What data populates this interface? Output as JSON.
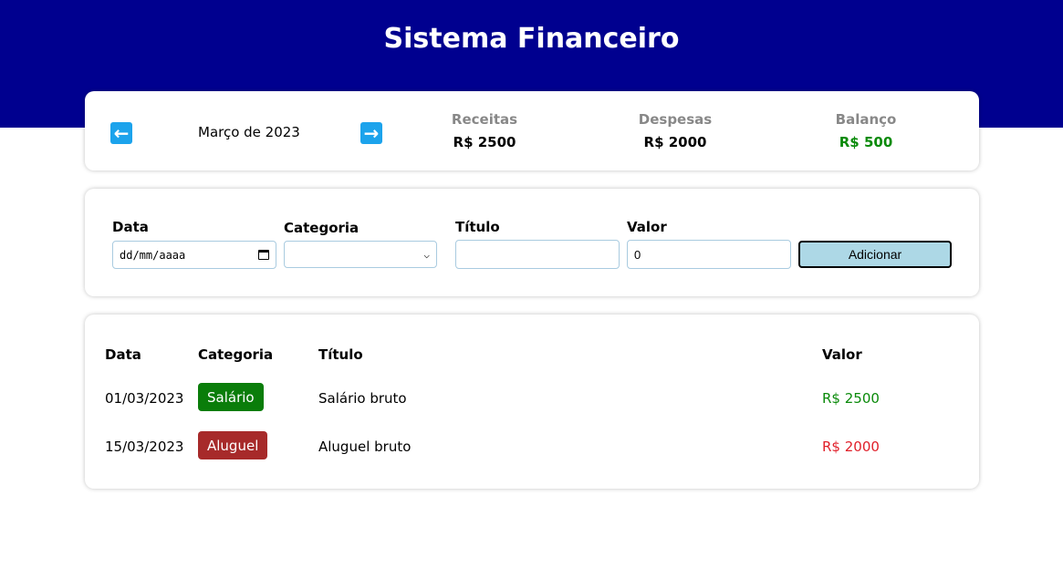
{
  "header": {
    "title": "Sistema Financeiro"
  },
  "summary": {
    "prev_icon": "arrow-left-icon",
    "next_icon": "arrow-right-icon",
    "month": "Março de 2023",
    "receitas": {
      "label": "Receitas",
      "value": "R$ 2500"
    },
    "despesas": {
      "label": "Despesas",
      "value": "R$ 2000"
    },
    "balanco": {
      "label": "Balanço",
      "value": "R$ 500",
      "color": "#0a8a0a"
    }
  },
  "form": {
    "data_label": "Data",
    "data_placeholder": "dd/mm/aaaa",
    "categoria_label": "Categoria",
    "categoria_value": "",
    "titulo_label": "Título",
    "titulo_value": "",
    "valor_label": "Valor",
    "valor_value": "0",
    "add_label": "Adicionar"
  },
  "table": {
    "headers": [
      "Data",
      "Categoria",
      "Título",
      "Valor"
    ],
    "rows": [
      {
        "date": "01/03/2023",
        "category": "Salário",
        "category_color": "#0a7d0a",
        "title": "Salário bruto",
        "value": "R$ 2500",
        "value_color": "#0a8a0a"
      },
      {
        "date": "15/03/2023",
        "category": "Aluguel",
        "category_color": "#a72a2a",
        "title": "Aluguel bruto",
        "value": "R$ 2000",
        "value_color": "#e0202a"
      }
    ]
  }
}
